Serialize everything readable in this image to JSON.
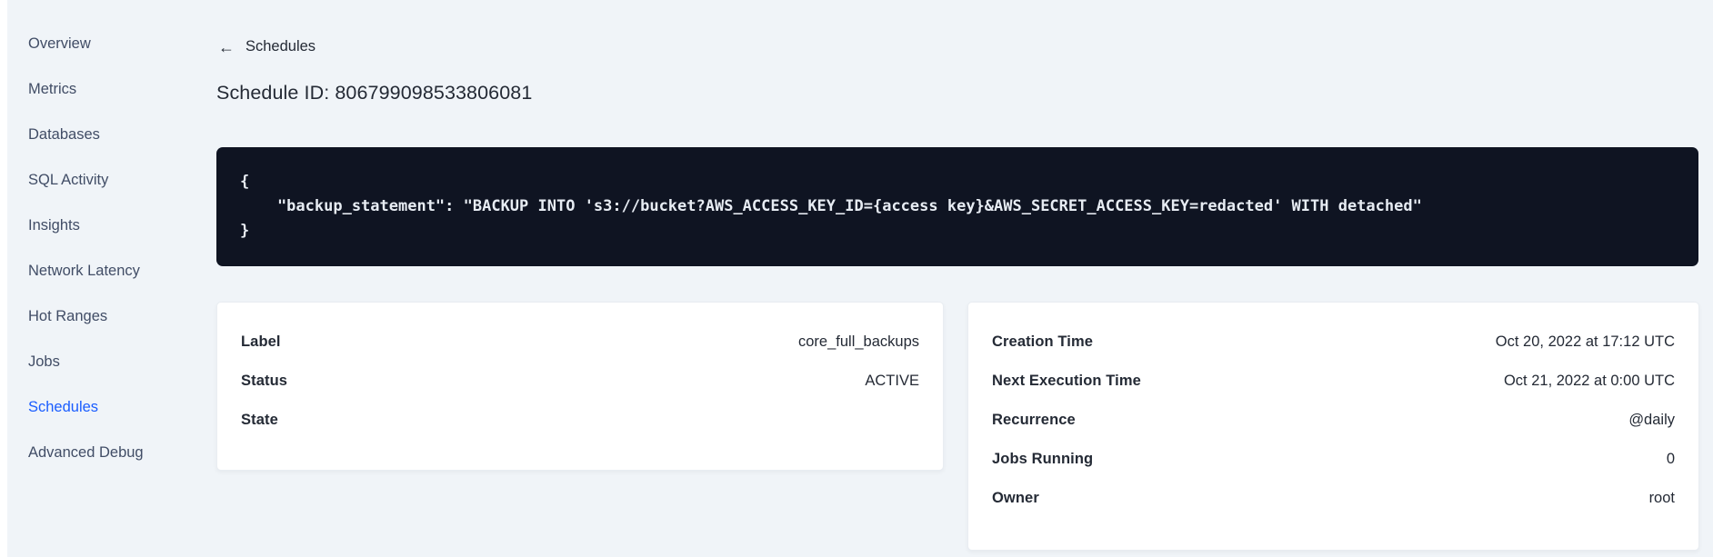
{
  "colors": {
    "page_bg": "#f0f4f8",
    "accent_blue": "#1a5dff",
    "code_block_bg": "#0f1422",
    "code_text": "#e7ecf3",
    "text_dark": "#242a35",
    "sidebar_text": "#414d66"
  },
  "sidebar": {
    "items": [
      {
        "label": "Overview",
        "active": false
      },
      {
        "label": "Metrics",
        "active": false
      },
      {
        "label": "Databases",
        "active": false
      },
      {
        "label": "SQL Activity",
        "active": false
      },
      {
        "label": "Insights",
        "active": false
      },
      {
        "label": "Network Latency",
        "active": false
      },
      {
        "label": "Hot Ranges",
        "active": false
      },
      {
        "label": "Jobs",
        "active": false
      },
      {
        "label": "Schedules",
        "active": true
      },
      {
        "label": "Advanced Debug",
        "active": false
      }
    ]
  },
  "header": {
    "back_icon": "←",
    "back_label": "Schedules",
    "title": "Schedule ID: 806799098533806081"
  },
  "code": {
    "lines": [
      "{",
      "    \"backup_statement\": \"BACKUP INTO 's3://bucket?AWS_ACCESS_KEY_ID={access key}&AWS_SECRET_ACCESS_KEY=redacted' WITH detached\"",
      "}"
    ]
  },
  "details": {
    "left_card": {
      "rows": [
        {
          "label": "Label",
          "value": "core_full_backups"
        },
        {
          "label": "Status",
          "value": "ACTIVE"
        },
        {
          "label": "State",
          "value": ""
        }
      ]
    },
    "right_card": {
      "rows": [
        {
          "label": "Creation Time",
          "value": "Oct 20, 2022 at 17:12 UTC"
        },
        {
          "label": "Next Execution Time",
          "value": "Oct 21, 2022 at 0:00 UTC"
        },
        {
          "label": "Recurrence",
          "value": "@daily"
        },
        {
          "label": "Jobs Running",
          "value": "0"
        },
        {
          "label": "Owner",
          "value": "root"
        }
      ]
    }
  }
}
